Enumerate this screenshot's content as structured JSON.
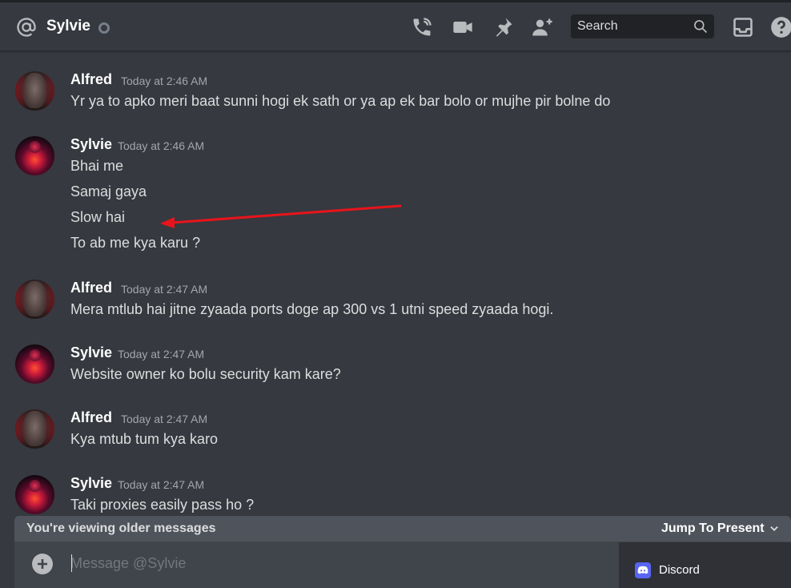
{
  "header": {
    "title": "Sylvie",
    "search_placeholder": "Search",
    "icons": [
      "at-icon",
      "call-icon",
      "video-icon",
      "pin-icon",
      "add-friend-icon",
      "search-icon",
      "inbox-icon",
      "help-icon"
    ]
  },
  "messages": [
    {
      "author": "Alfred",
      "time": "Today at 2:46 AM",
      "avatar": "alfred",
      "lines": [
        "Yr ya to apko meri baat sunni hogi ek sath or ya ap ek bar bolo or mujhe pir bolne do"
      ]
    },
    {
      "author": "Sylvie",
      "time": "Today at 2:46 AM",
      "avatar": "sylvie",
      "lines": [
        "Bhai me",
        "Samaj gaya",
        "Slow hai",
        "To ab me kya karu ?"
      ]
    },
    {
      "author": "Alfred",
      "time": "Today at 2:47 AM",
      "avatar": "alfred",
      "lines": [
        "Mera mtlub hai jitne zyaada ports doge ap 300 vs 1 utni speed zyaada hogi."
      ]
    },
    {
      "author": "Sylvie",
      "time": "Today at 2:47 AM",
      "avatar": "sylvie",
      "lines": [
        "Website owner ko bolu security kam kare?"
      ]
    },
    {
      "author": "Alfred",
      "time": "Today at 2:47 AM",
      "avatar": "alfred",
      "lines": [
        "Kya mtub tum kya karo"
      ]
    },
    {
      "author": "Sylvie",
      "time": "Today at 2:47 AM",
      "avatar": "sylvie",
      "lines": [
        "Taki proxies easily pass ho ?"
      ]
    }
  ],
  "older_bar": {
    "label": "You're viewing older messages",
    "jump": "Jump To Present"
  },
  "composer": {
    "placeholder": "Message @Sylvie"
  },
  "toast": {
    "label": "Discord"
  },
  "colors": {
    "background": "#36393f",
    "annotation_arrow": "#e8141b",
    "blurple": "#5865f2"
  }
}
